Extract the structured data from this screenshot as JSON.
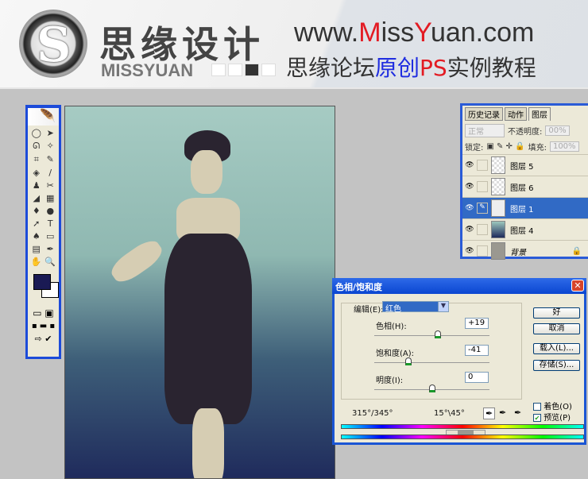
{
  "banner": {
    "logo_letter": "S",
    "brand_cn": "思缘设计",
    "brand_en": "MISSYUAN",
    "url_pre": "www.",
    "url_m": "M",
    "url_iss": "iss",
    "url_y": "Y",
    "url_post": "uan.com",
    "slogan_a": "思缘论坛",
    "slogan_b": "原创",
    "slogan_c": "PS",
    "slogan_d": "实例教程"
  },
  "toolbox": {
    "tools": [
      "◯",
      "➤",
      "ᘏ",
      "✧",
      "⌗",
      "✎",
      "◈",
      "/",
      "♟",
      "✂",
      "◢",
      "▦",
      "♦",
      "●",
      "➚",
      "T",
      "♠",
      "▭",
      "▤",
      "✒",
      "✋",
      "🔍"
    ],
    "fg_color": "#1a1a54",
    "bg_color": "#ffffff"
  },
  "layers_panel": {
    "tabs": [
      "历史记录",
      "动作",
      "图层"
    ],
    "active_tab": "图层",
    "blend_mode": "正常",
    "opacity_label": "不透明度:",
    "opacity_value": "00%",
    "lock_label": "锁定:",
    "fill_label": "填充:",
    "fill_value": "100%",
    "layers": [
      {
        "name": "图层 5",
        "selected": false
      },
      {
        "name": "图层 6",
        "selected": false
      },
      {
        "name": "图层 1",
        "selected": true
      },
      {
        "name": "图层 4",
        "selected": false
      },
      {
        "name": "背景",
        "selected": false
      }
    ]
  },
  "dialog": {
    "title": "色相/饱和度",
    "edit_label": "编辑(E):",
    "edit_value": "红色",
    "hue_label": "色相(H):",
    "hue_value": "+19",
    "hue": 19,
    "sat_label": "饱和度(A):",
    "sat_value": "-41",
    "saturation": -41,
    "light_label": "明度(I):",
    "light_value": "0",
    "lightness": 0,
    "ok": "好",
    "cancel": "取消",
    "load": "载入(L)...",
    "save": "存储(S)...",
    "colorize_label": "着色(O)",
    "colorize": false,
    "preview_label": "预览(P)",
    "preview": true,
    "range_left": "315°/345°",
    "range_right": "15°\\45°"
  }
}
